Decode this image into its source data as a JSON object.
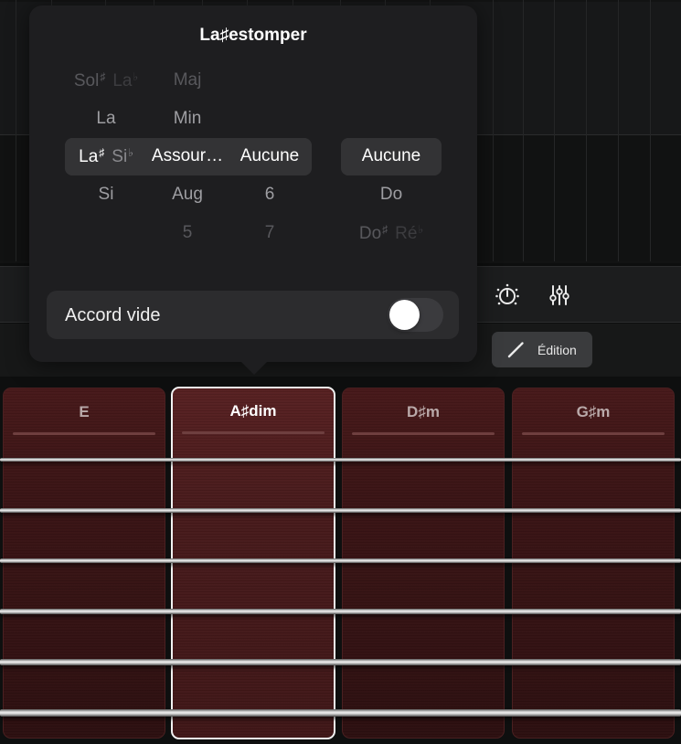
{
  "popover": {
    "title": "La♯estomper",
    "columns": {
      "root": {
        "items": [
          {
            "label": "Sol♯",
            "alt": "La♭",
            "state": "far"
          },
          {
            "label": "La",
            "alt": "",
            "state": "near"
          },
          {
            "label": "La♯",
            "alt": "Si♭",
            "state": "selected"
          },
          {
            "label": "Si",
            "alt": "",
            "state": "near"
          }
        ]
      },
      "quality": {
        "items": [
          {
            "label": "Maj",
            "state": "far"
          },
          {
            "label": "Min",
            "state": "near"
          },
          {
            "label": "Assour…",
            "state": "selected"
          },
          {
            "label": "Aug",
            "state": "near"
          },
          {
            "label": "5",
            "state": "far"
          }
        ]
      },
      "extension": {
        "items": [
          {
            "label": "Aucune",
            "state": "selected"
          },
          {
            "label": "6",
            "state": "near"
          },
          {
            "label": "7",
            "state": "far"
          }
        ]
      },
      "bass": {
        "items": [
          {
            "label": "Aucune",
            "state": "selected"
          },
          {
            "label": "Do",
            "state": "near"
          },
          {
            "label": "Do♯",
            "alt": "Ré♭",
            "state": "far"
          }
        ]
      }
    },
    "toggle": {
      "label": "Accord vide",
      "on": false
    }
  },
  "toolbar": {
    "icons": [
      "knob-dial-icon",
      "mixer-sliders-icon"
    ],
    "edit_label": "Édition"
  },
  "chords": [
    {
      "name": "E",
      "selected": false
    },
    {
      "name": "A♯dim",
      "selected": true
    },
    {
      "name": "D♯m",
      "selected": false
    },
    {
      "name": "G♯m",
      "selected": false
    }
  ],
  "strings_count": 6,
  "colors": {
    "selected_border": "#f2f2f2",
    "chord_fill": "#3d1516",
    "popover_bg": "#1e1e20"
  }
}
